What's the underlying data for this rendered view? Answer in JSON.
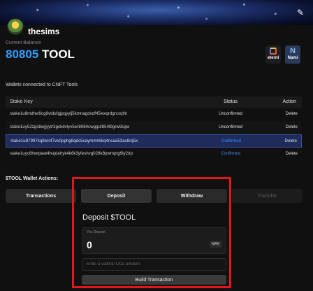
{
  "profile": {
    "username": "thesims"
  },
  "balance": {
    "label": "Current Balance",
    "amount": "80805",
    "unit": "TOOL",
    "accent_color": "#2ea0ff"
  },
  "wallet_buttons": [
    {
      "label": "eternl",
      "icon": "eternl-wallet-icon"
    },
    {
      "label": "Nami",
      "icon": "nami-wallet-icon",
      "glyph": "N"
    }
  ],
  "wallets": {
    "title": "Wallets connected to CNFT Tools",
    "headers": {
      "key": "Stake Key",
      "status": "Status",
      "action": "Action"
    },
    "rows": [
      {
        "key": "stake1u8mdhw9cg8vtdufgjpqyylj5kmnagdxdf45wxqrdgrcsqlhl",
        "status": "Unconfirmed",
        "action": "Delete"
      },
      {
        "key": "stake1uy52zgs8wjjyytr3gckdvlyv5er8084cwgguf854l9grw9cgw",
        "status": "Unconfirmed",
        "action": "Delete"
      },
      {
        "key": "stake1u87997kq9ernf7ve0pphg8qdc5caymmmlkq4ncaa53ac8rq5x",
        "status": "Confirmed",
        "action": "Delete"
      },
      {
        "key": "stake1uyc8hwqtaat4hujdalryk4k6k3yfeshvg028k8pwmptg9ly2dp",
        "status": "Confirmed",
        "action": "Delete"
      }
    ]
  },
  "actions": {
    "title": "$TOOL Wallet Actions:",
    "tabs": {
      "transactions": "Transactions",
      "deposit": "Deposit",
      "withdraw": "Withdraw",
      "transfer": "Transfer"
    }
  },
  "deposit": {
    "title": "Deposit $TOOL",
    "you_deposit_label": "You Deposit",
    "you_deposit_value": "0",
    "max_label": "MAX",
    "amount_placeholder": "Enter a valid $TOOL amount",
    "build_label": "Build Transaction"
  },
  "colors": {
    "confirmed": "#3a8bff",
    "highlight": "#e01818",
    "selected_row": "#1f2b5a"
  }
}
